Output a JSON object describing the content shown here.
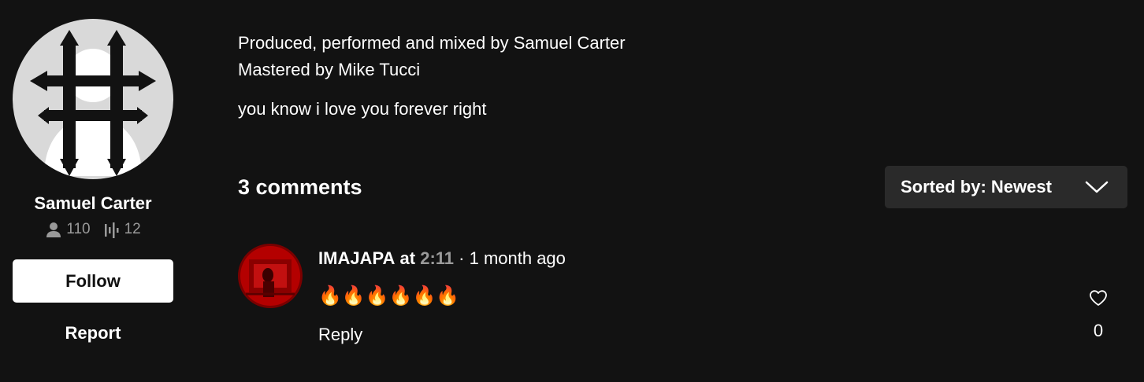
{
  "artist": {
    "name": "Samuel Carter",
    "followers": "110",
    "tracks": "12",
    "follow_label": "Follow",
    "report_label": "Report"
  },
  "description": {
    "lines": [
      "Produced, performed and mixed by Samuel Carter",
      "Mastered by Mike Tucci"
    ],
    "caption": "you know i love you forever right"
  },
  "comments_section": {
    "count_label": "3 comments",
    "sort_label": "Sorted by: Newest"
  },
  "comments": [
    {
      "user": "IMAJAPA",
      "at_label": "at",
      "timestamp": "2:11",
      "ago": "· 1 month ago",
      "body": "🔥🔥🔥🔥🔥🔥",
      "reply_label": "Reply",
      "likes": "0"
    }
  ],
  "colors": {
    "background": "#121212",
    "muted_text": "#9a9a9a",
    "sort_button_bg": "#2a2a2a",
    "comment_avatar_red": "#b40000"
  },
  "icons": {
    "avatar": "double-cross-logo",
    "followers": "person-icon",
    "tracks": "waveform-icon",
    "sort": "chevron-down-icon",
    "like": "heart-icon"
  }
}
